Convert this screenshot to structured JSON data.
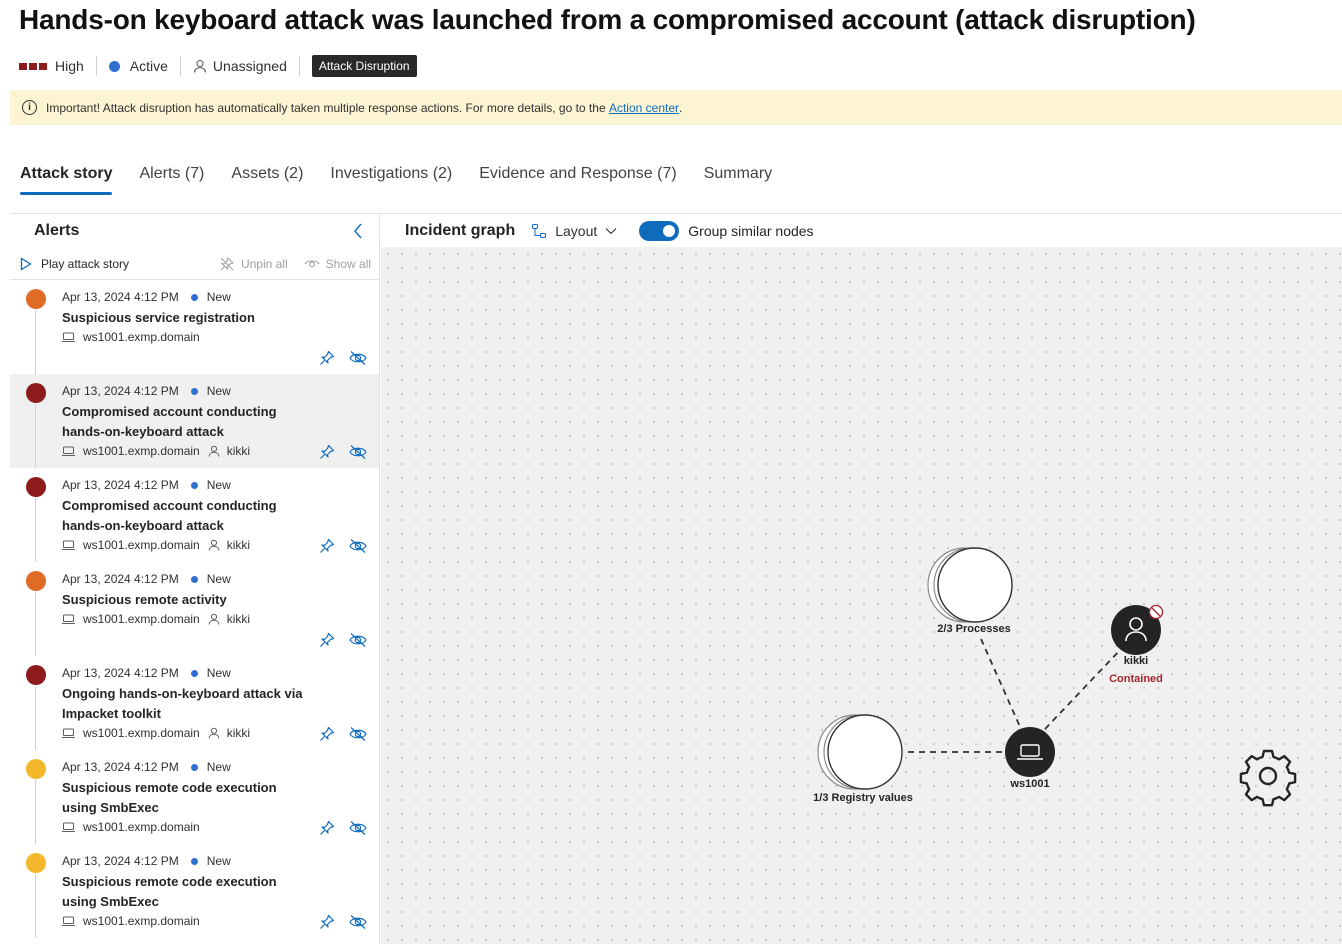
{
  "incident": {
    "title": "Hands-on keyboard attack was launched from a compromised account (attack disruption)",
    "severity": "High",
    "status": "Active",
    "assignee": "Unassigned",
    "tag": "Attack Disruption",
    "severity_color": "#8e1b1b"
  },
  "banner": {
    "icon": "info-icon",
    "text": "Important! Attack disruption has automatically taken multiple response actions. For more details, go to the ",
    "link": "Action center",
    "suffix": "."
  },
  "tabs": [
    {
      "label": "Attack story",
      "active": true
    },
    {
      "label": "Alerts (7)",
      "active": false
    },
    {
      "label": "Assets (2)",
      "active": false
    },
    {
      "label": "Investigations (2)",
      "active": false
    },
    {
      "label": "Evidence and Response (7)",
      "active": false
    },
    {
      "label": "Summary",
      "active": false
    }
  ],
  "alerts_panel": {
    "title": "Alerts",
    "play_label": "Play attack story",
    "unpin_label": "Unpin all",
    "show_label": "Show all",
    "items": [
      {
        "severity_color": "#e06b25",
        "date": "Apr 13, 2024 4:12 PM",
        "status": "New",
        "name": "Suspicious service registration",
        "device": "ws1001.exmp.domain",
        "user": ""
      },
      {
        "severity_color": "#8e1b1b",
        "date": "Apr 13, 2024 4:12 PM",
        "status": "New",
        "name": "Compromised account conducting hands-on-keyboard attack",
        "device": "ws1001.exmp.domain",
        "user": "kikki",
        "selected": true
      },
      {
        "severity_color": "#8e1b1b",
        "date": "Apr 13, 2024 4:12 PM",
        "status": "New",
        "name": "Compromised account conducting hands-on-keyboard attack",
        "device": "ws1001.exmp.domain",
        "user": "kikki"
      },
      {
        "severity_color": "#e06b25",
        "date": "Apr 13, 2024 4:12 PM",
        "status": "New",
        "name": "Suspicious remote activity",
        "device": "ws1001.exmp.domain",
        "user": "kikki"
      },
      {
        "severity_color": "#8e1b1b",
        "date": "Apr 13, 2024 4:12 PM",
        "status": "New",
        "name": "Ongoing hands-on-keyboard attack via Impacket toolkit",
        "device": "ws1001.exmp.domain",
        "user": "kikki"
      },
      {
        "severity_color": "#f2b72b",
        "date": "Apr 13, 2024 4:12 PM",
        "status": "New",
        "name": "Suspicious remote code execution using SmbExec",
        "device": "ws1001.exmp.domain",
        "user": ""
      },
      {
        "severity_color": "#f2b72b",
        "date": "Apr 13, 2024 4:12 PM",
        "status": "New",
        "name": "Suspicious remote code execution using SmbExec",
        "device": "ws1001.exmp.domain",
        "user": ""
      }
    ]
  },
  "graph": {
    "title": "Incident graph",
    "layout_label": "Layout",
    "group_label": "Group similar nodes",
    "group_enabled": true,
    "nodes": {
      "processes": "2/3 Processes",
      "registry": "1/3 Registry values",
      "device": "ws1001",
      "user": "kikki",
      "user_status": "Contained"
    },
    "contained_color": "#a4262c"
  }
}
